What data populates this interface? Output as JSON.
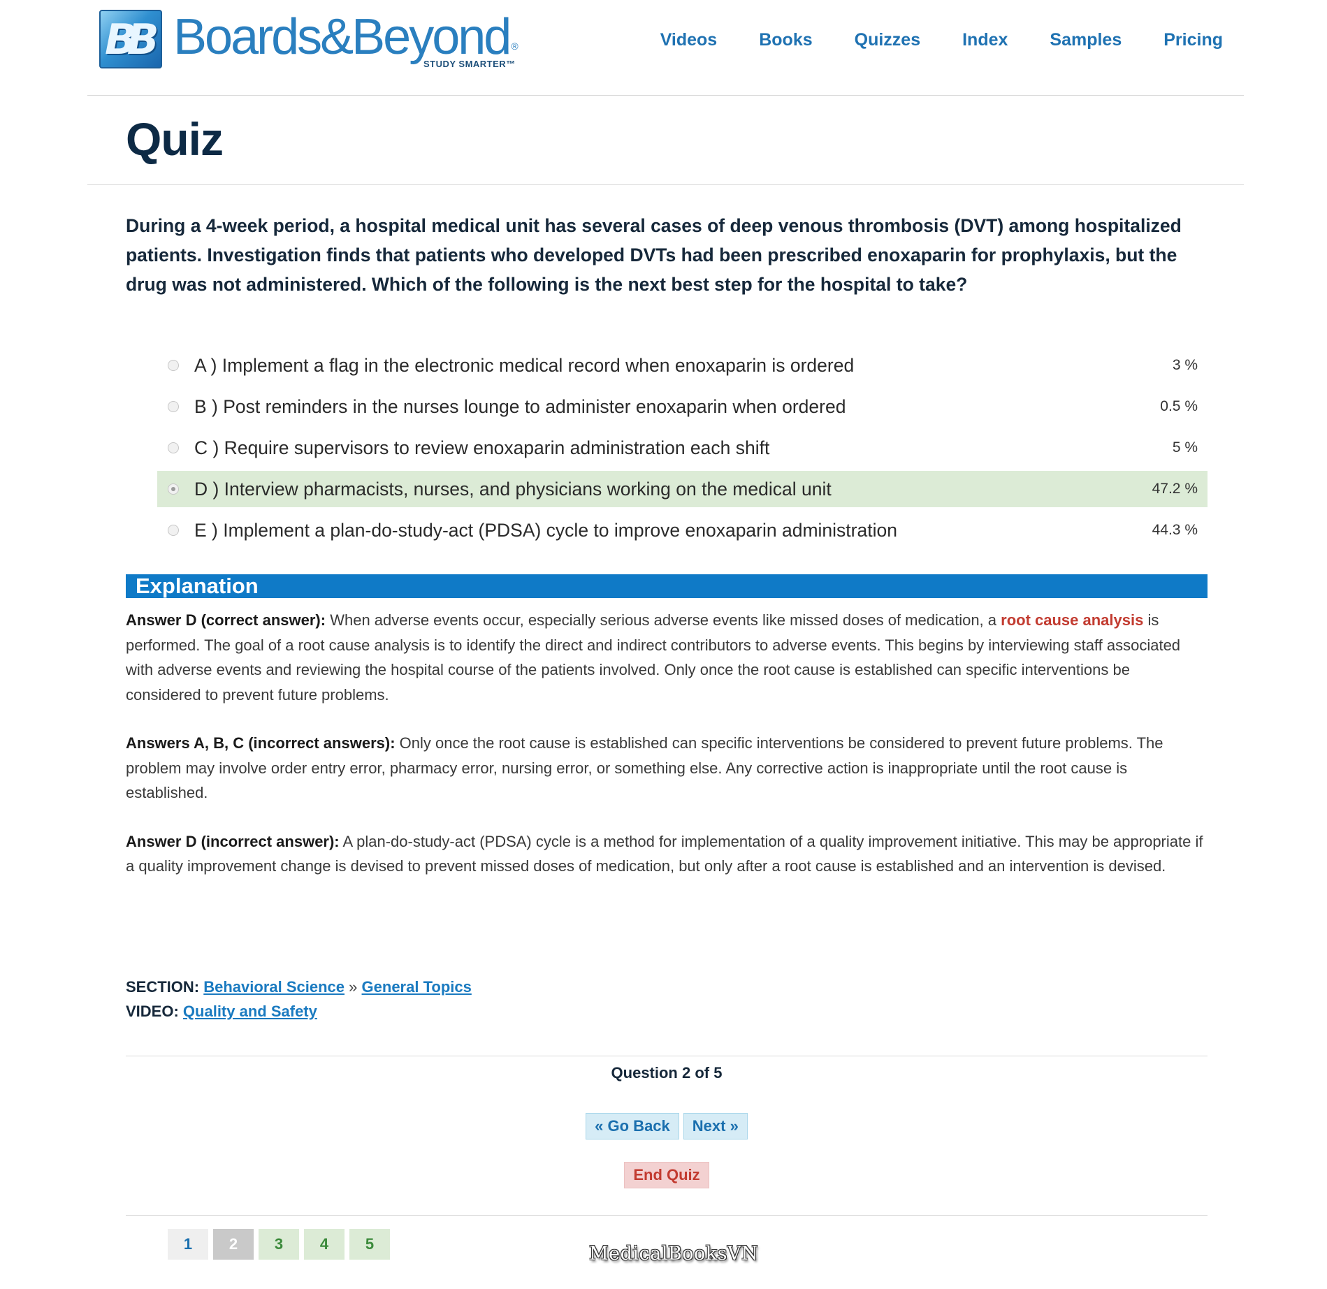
{
  "header": {
    "logo": {
      "mark": "BB",
      "name": "Boards&Beyond",
      "registered": "®",
      "tagline": "STUDY SMARTER™"
    },
    "nav": [
      "Videos",
      "Books",
      "Quizzes",
      "Index",
      "Samples",
      "Pricing"
    ]
  },
  "page": {
    "title": "Quiz"
  },
  "question": {
    "text": "During a 4-week period, a hospital medical unit has several cases of deep venous thrombosis (DVT) among hospitalized patients. Investigation finds that patients who developed DVTs had been prescribed enoxaparin for prophylaxis, but the drug was not administered. Which of the following is the next best step for the hospital to take?"
  },
  "answers": [
    {
      "label": "A ) Implement a flag in the electronic medical record when enoxaparin is ordered",
      "percent": "3 %",
      "selected": false
    },
    {
      "label": "B ) Post reminders in the nurses lounge to administer enoxaparin when ordered",
      "percent": "0.5 %",
      "selected": false
    },
    {
      "label": "C ) Require supervisors to review enoxaparin administration each shift",
      "percent": "5 %",
      "selected": false
    },
    {
      "label": "D ) Interview pharmacists, nurses, and physicians working on the medical unit",
      "percent": "47.2 %",
      "selected": true
    },
    {
      "label": "E ) Implement a plan-do-study-act (PDSA) cycle to improve enoxaparin administration",
      "percent": "44.3 %",
      "selected": false
    }
  ],
  "explanation": {
    "heading": "Explanation",
    "p1": {
      "lead": "Answer D (correct answer):",
      "before": " When adverse events occur, especially serious adverse events like missed doses of medication, a ",
      "highlight": "root cause analysis",
      "after": " is performed. The goal of a root cause analysis is to identify the direct and indirect contributors to adverse events. This begins by interviewing staff associated with adverse events and reviewing the hospital course of the patients involved. Only once the root cause is established can specific interventions be considered to prevent future problems."
    },
    "p2": {
      "lead": "Answers A, B, C (incorrect answers):",
      "body": " Only once the root cause is established can specific interventions be considered to prevent future problems. The problem may involve order entry error, pharmacy error, nursing error, or something else. Any corrective action is inappropriate until the root cause is established."
    },
    "p3": {
      "lead": "Answer D (incorrect answer):",
      "body": " A plan-do-study-act (PDSA) cycle is a method for implementation of a quality improvement initiative. This may be appropriate if a quality improvement change is devised to prevent missed doses of medication, but only after a root cause is established and an intervention is devised."
    }
  },
  "meta": {
    "section_label": "SECTION:",
    "section_link1": "Behavioral Science",
    "separator": "»",
    "section_link2": "General Topics",
    "video_label": "VIDEO:",
    "video_link": "Quality and Safety"
  },
  "navigation": {
    "counter": "Question 2 of 5",
    "back": "« Go Back",
    "next": "Next »",
    "end": "End Quiz"
  },
  "pager": [
    {
      "num": "1",
      "state": "plain"
    },
    {
      "num": "2",
      "state": "current"
    },
    {
      "num": "3",
      "state": "done"
    },
    {
      "num": "4",
      "state": "done"
    },
    {
      "num": "5",
      "state": "done"
    }
  ],
  "watermark": "MedicalBooksVN",
  "colors": {
    "brand_blue": "#1f72b2",
    "title_navy": "#0d2a45",
    "explanation_bar": "#0f7ac7",
    "selected_answer_bg": "#dcebd6",
    "highlight_red": "#c23b30"
  }
}
